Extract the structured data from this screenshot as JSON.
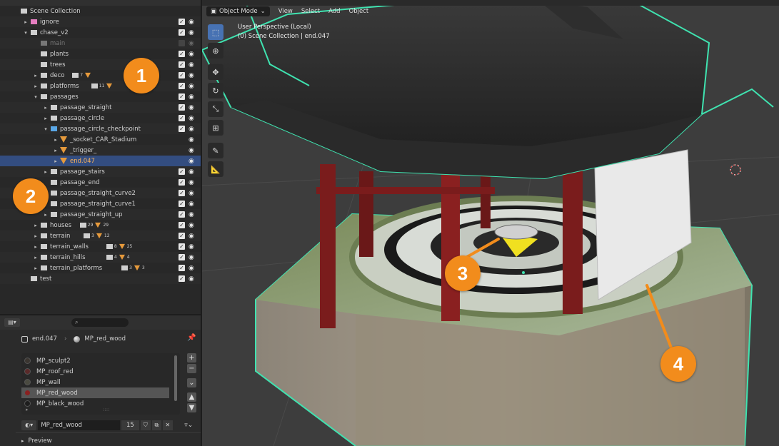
{
  "outliner": {
    "rows": [
      {
        "label": "Scene Collection",
        "icon": "scene-collection-icon"
      },
      {
        "label": "ignore",
        "icon": "collection-icon"
      },
      {
        "label": "chase_v2",
        "icon": "collection-icon"
      },
      {
        "label": "main",
        "icon": "collection-icon"
      },
      {
        "label": "plants",
        "icon": "collection-icon"
      },
      {
        "label": "trees",
        "icon": "collection-icon"
      },
      {
        "label": "deco",
        "icon": "collection-icon",
        "count": "7"
      },
      {
        "label": "platforms",
        "icon": "collection-icon",
        "count": "11"
      },
      {
        "label": "passages",
        "icon": "collection-icon"
      },
      {
        "label": "passage_straight",
        "icon": "collection-icon"
      },
      {
        "label": "passage_circle",
        "icon": "collection-icon"
      },
      {
        "label": "passage_circle_checkpoint",
        "icon": "collection-icon"
      },
      {
        "label": "_socket_CAR_Stadium",
        "icon": "mesh-object-icon"
      },
      {
        "label": "_trigger_",
        "icon": "mesh-object-icon"
      },
      {
        "label": "end.047",
        "icon": "mesh-object-icon"
      },
      {
        "label": "passage_stairs",
        "icon": "collection-icon"
      },
      {
        "label": "passage_end",
        "icon": "collection-icon"
      },
      {
        "label": "passage_straight_curve2",
        "icon": "collection-icon"
      },
      {
        "label": "passage_straight_curve1",
        "icon": "collection-icon"
      },
      {
        "label": "passage_straight_up",
        "icon": "collection-icon"
      },
      {
        "label": "houses",
        "icon": "collection-icon",
        "count": "29",
        "count2": "29"
      },
      {
        "label": "terrain",
        "icon": "collection-icon",
        "count": "3",
        "count2": "12"
      },
      {
        "label": "terrain_walls",
        "icon": "collection-icon",
        "count": "8",
        "count2": "25"
      },
      {
        "label": "terrain_hills",
        "icon": "collection-icon",
        "count": "4",
        "count2": "4"
      },
      {
        "label": "terrain_platforms",
        "icon": "collection-icon",
        "count": "3",
        "count2": "3"
      },
      {
        "label": "test",
        "icon": "collection-icon"
      }
    ]
  },
  "properties": {
    "object_name": "end.047",
    "material_name": "MP_red_wood",
    "slots": [
      "MP_sculpt2",
      "MP_roof_red",
      "MP_wall",
      "MP_red_wood",
      "MP_black_wood"
    ],
    "selected_slot": "MP_red_wood",
    "material_field": "MP_red_wood",
    "users": "15",
    "preview_label": "Preview",
    "colors": {
      "MP_sculpt2": "#3a3530",
      "MP_roof_red": "#5a2a2a",
      "MP_wall": "#4a4a40",
      "MP_red_wood": "#8a2020",
      "MP_black_wood": "#1e1e1e"
    }
  },
  "viewport": {
    "mode": "Object Mode",
    "menus": [
      "View",
      "Select",
      "Add",
      "Object"
    ],
    "info_line1": "User Perspective (Local)",
    "info_line2": "(0) Scene Collection | end.047"
  },
  "callouts": [
    "1",
    "2",
    "3",
    "4"
  ],
  "colors": {
    "accent": "#f28c1c",
    "selection": "#334d80",
    "outline": "#3fe3b0"
  }
}
